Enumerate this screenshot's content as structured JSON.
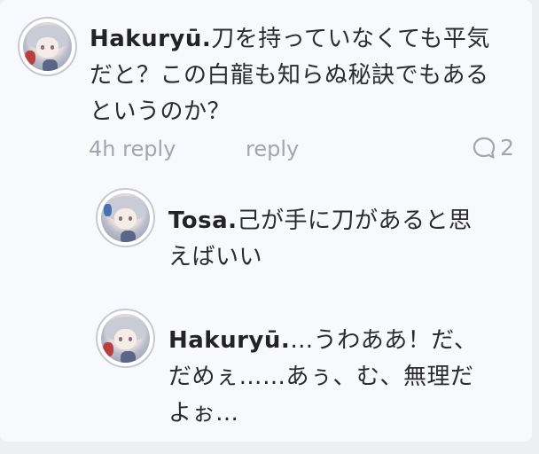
{
  "main_comment": {
    "author": "Hakuryū.",
    "text": "刀を持っていなくても平気だと？この白龍も知らぬ秘訣でもあるというのか？",
    "time": "4h",
    "reply_label": "reply",
    "reply_action_label": "reply",
    "reply_count": "2"
  },
  "replies": [
    {
      "author": "Tosa.",
      "text": "己が手に刀があると思えばいい"
    },
    {
      "author": "Hakuryū.",
      "text": "…うわああ！だ、だめぇ……あぅ、む、無理だよぉ…"
    }
  ],
  "icons": {
    "comment_icon": "speech-bubble-icon"
  },
  "colors": {
    "card_background": "#f8f9fd",
    "page_background": "#eeeff3",
    "text": "#2b2b2f",
    "meta": "#a4a6af"
  }
}
